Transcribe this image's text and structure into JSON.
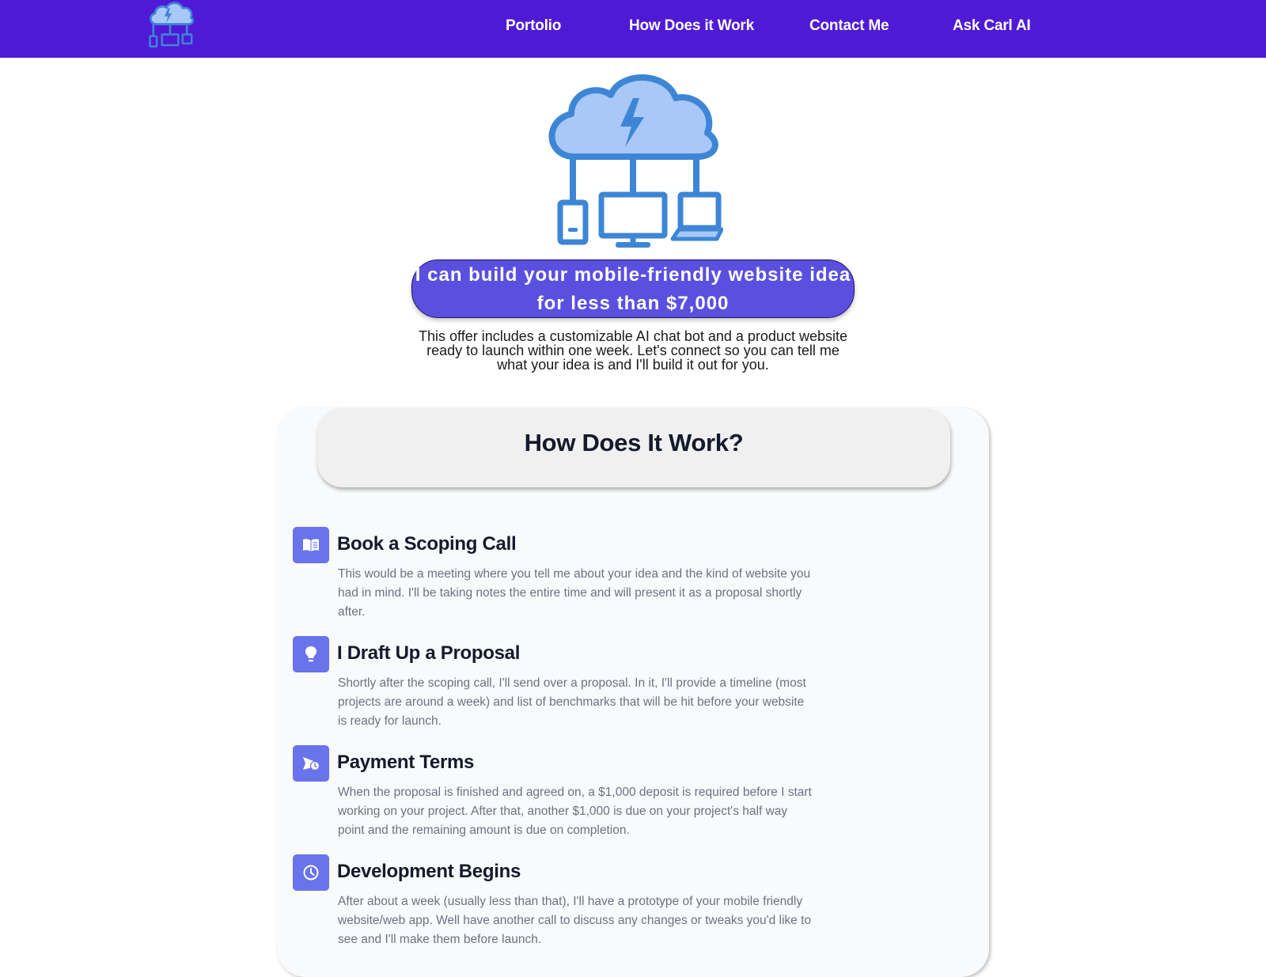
{
  "nav": {
    "logo_icon": "cloud-devices-logo-icon",
    "links": [
      {
        "label": "Portolio"
      },
      {
        "label": "How Does it Work"
      },
      {
        "label": "Contact Me"
      },
      {
        "label": "Ask Carl AI"
      }
    ],
    "background_color": "#4f1ad6"
  },
  "hero": {
    "illustration_icon": "cloud-lightning-devices-icon",
    "headline_line1": "I can build your mobile-friendly website idea",
    "headline_line2": "for less than $7,000",
    "subtext_line1": "This offer includes a customizable AI chat bot and a product website",
    "subtext_line2": "ready to launch within one week. Let's connect so you can tell me",
    "subtext_line3": "what your idea is and I'll build it out for you.",
    "pill_color": "#5a50e0"
  },
  "how_it_works": {
    "title": "How Does It Work?",
    "icon_color": "#6973ea",
    "steps": [
      {
        "icon": "book-icon",
        "title": "Book a Scoping Call",
        "description": "This would be a meeting where you tell me about your idea and the kind of website you had in mind. I'll be taking notes the entire time and will present it as a proposal shortly after."
      },
      {
        "icon": "lightbulb-icon",
        "title": "I Draft Up a Proposal",
        "description": "Shortly after the scoping call, I'll send over a proposal. In it, I'll provide a timeline (most projects are around a week) and list of benchmarks that will be hit before your website is ready for launch."
      },
      {
        "icon": "payment-schedule-icon",
        "title": "Payment Terms",
        "description": "When the proposal is finished and agreed on, a $1,000 deposit is required before I start working on your project. After that, another $1,000 is due on your project's half way point and the remaining amount is due on completion."
      },
      {
        "icon": "clock-icon",
        "title": "Development Begins",
        "description": "After about a week (usually less than that), I'll have a prototype of your mobile friendly website/web app. Well have another call to discuss any changes or tweaks you'd like to see and I'll make them before launch."
      }
    ]
  }
}
